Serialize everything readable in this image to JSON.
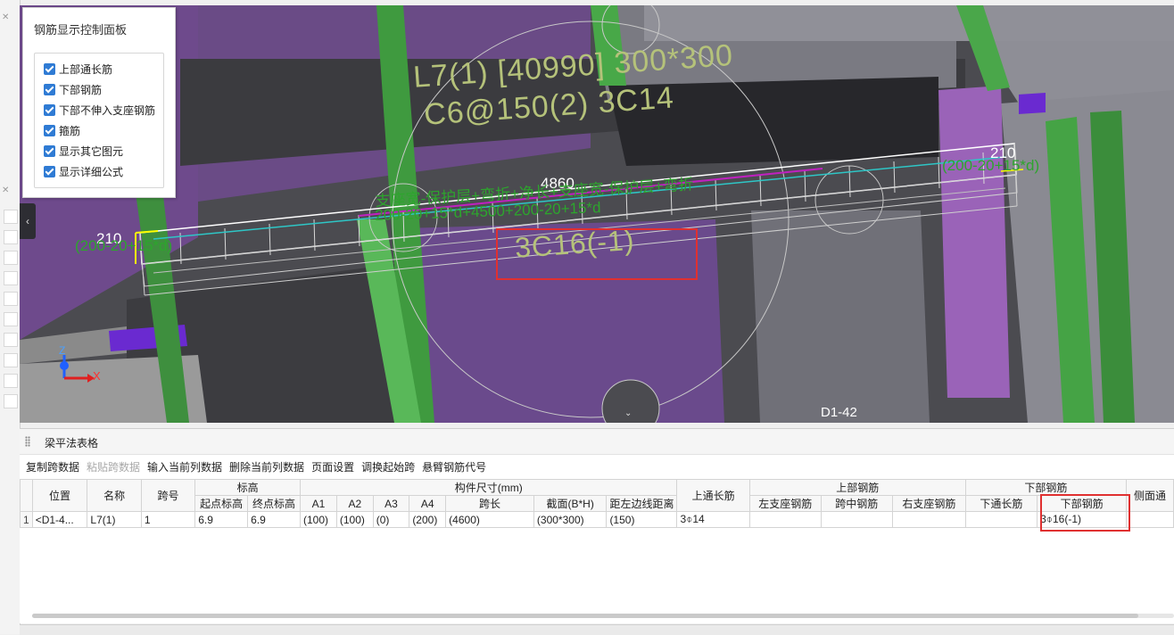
{
  "panel": {
    "title": "钢筋显示控制面板",
    "options": [
      {
        "label": "上部通长筋",
        "checked": true
      },
      {
        "label": "下部钢筋",
        "checked": true
      },
      {
        "label": "下部不伸入支座钢筋",
        "checked": true
      },
      {
        "label": "箍筋",
        "checked": true
      },
      {
        "label": "显示其它图元",
        "checked": true
      },
      {
        "label": "显示详细公式",
        "checked": true
      }
    ]
  },
  "viewport": {
    "beam_label_line1": "L7(1) [40990] 300*300",
    "beam_label_line2": "C6@150(2) 3C14",
    "length_dim": "4860",
    "formula_desc": "支座宽-保护层+弯折+净长+支座宽-保护层+弯折",
    "formula_value": "200-20+15*d+4500+200-20+15*d",
    "left_end_value": "210",
    "left_end_formula": "(200-20+15*d)",
    "right_end_value": "210",
    "right_end_formula": "(200-20+15*d)",
    "bottom_bar_label": "3C16(-1)",
    "axis_z": "Z",
    "axis_x": "X",
    "element_label": "D1-42"
  },
  "grid_pane": {
    "title": "梁平法表格",
    "toolbar": [
      {
        "label": "复制跨数据",
        "enabled": true
      },
      {
        "label": "粘贴跨数据",
        "enabled": false
      },
      {
        "label": "输入当前列数据",
        "enabled": true
      },
      {
        "label": "删除当前列数据",
        "enabled": true
      },
      {
        "label": "页面设置",
        "enabled": true
      },
      {
        "label": "调换起始跨",
        "enabled": true
      },
      {
        "label": "悬臂钢筋代号",
        "enabled": true
      }
    ],
    "headers": {
      "position": "位置",
      "name": "名称",
      "span_no": "跨号",
      "elevation": "标高",
      "start_elev": "起点标高",
      "end_elev": "终点标高",
      "member_size": "构件尺寸(mm)",
      "a1": "A1",
      "a2": "A2",
      "a3": "A3",
      "a4": "A4",
      "span_len": "跨长",
      "section": "截面(B*H)",
      "edge_dist": "距左边线距离",
      "top_continuous": "上通长筋",
      "top_rebar": "上部钢筋",
      "left_support": "左支座钢筋",
      "mid_span": "跨中钢筋",
      "right_support": "右支座钢筋",
      "bottom_rebar": "下部钢筋",
      "bottom_continuous": "下通长筋",
      "bottom_rebar_sub": "下部钢筋",
      "side_continuous": "侧面通"
    },
    "row": {
      "num": "1",
      "position": "<D1-4...",
      "name": "L7(1)",
      "span_no": "1",
      "start_elev": "6.9",
      "end_elev": "6.9",
      "a1": "(100)",
      "a2": "(100)",
      "a3": "(0)",
      "a4": "(200)",
      "span_len": "(4600)",
      "section": "(300*300)",
      "edge_dist": "(150)",
      "top_continuous": "3⌽14",
      "left_support": "",
      "mid_span": "",
      "right_support": "",
      "bottom_continuous": "",
      "bottom_rebar": "3⌽16(-1)",
      "side_continuous": ""
    }
  },
  "colors": {
    "purple": "#6e4a8c",
    "green": "#46a446",
    "highlight_red": "#e03030",
    "checkbox_blue": "#2f7bd4"
  }
}
